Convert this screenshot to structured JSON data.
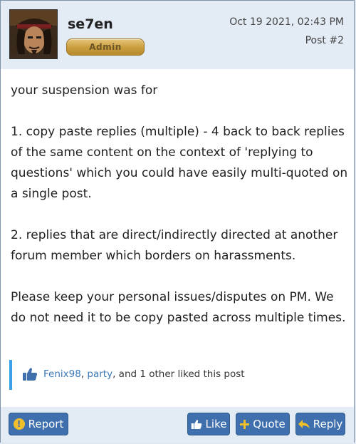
{
  "post": {
    "username": "se7en",
    "role": "Admin",
    "date": "Oct 19 2021, 02:43 PM",
    "post_number": "Post #2",
    "body": [
      "your suspension was for",
      "1. copy paste replies (multiple) - 4 back to back replies of the same content on the context of 'replying to questions' which you could have easily multi-quoted on a single post.",
      "2. replies that are direct/indirectly directed at another forum member which borders on harassments.",
      "Please keep your personal issues/disputes on PM. We do not need it to be copy pasted across multiple times."
    ]
  },
  "likes": {
    "user1": "Fenix98",
    "separator": ", ",
    "user2": "party",
    "rest": ", and 1 other liked this post"
  },
  "footer": {
    "report_label": "Report",
    "like_label": "Like",
    "quote_label": "Quote",
    "reply_label": "Reply"
  },
  "colors": {
    "header_bg": "#e3ebf5",
    "button_bg": "#3f6fad",
    "badge_gold": "#c99c3b",
    "like_bar_accent": "#3aa0e8",
    "link": "#3a78b8"
  },
  "icons": {
    "avatar": "pirate-avatar",
    "likes": "thumbs-up-icon",
    "report": "warning-icon",
    "like": "thumbs-up-icon",
    "quote": "plus-icon",
    "reply": "reply-arrow-icon"
  }
}
